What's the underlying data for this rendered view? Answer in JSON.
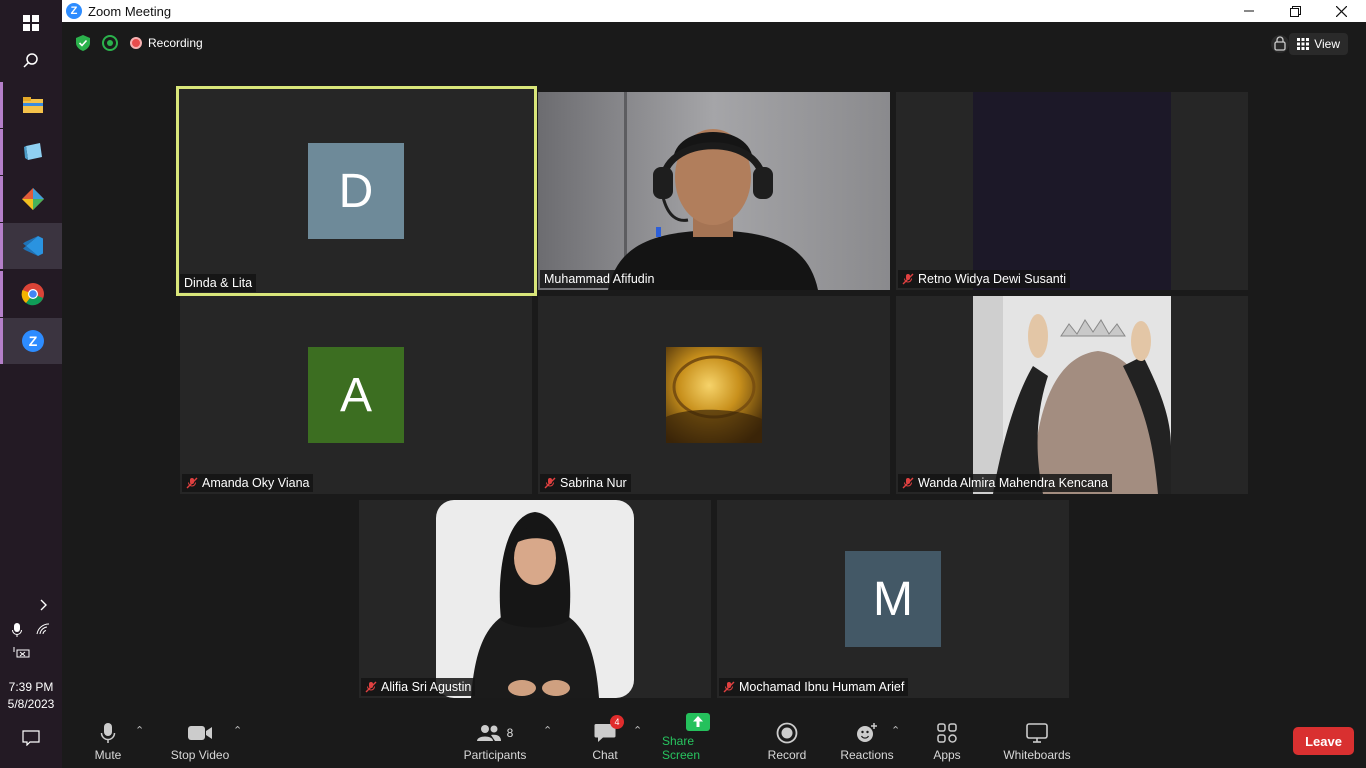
{
  "window": {
    "title": "Zoom Meeting"
  },
  "taskbar": {
    "time": "7:39 PM",
    "date": "5/8/2023"
  },
  "meeting": {
    "recording_label": "Recording",
    "view_label": "View"
  },
  "participants": [
    {
      "name": "Dinda & Lita",
      "initial": "D",
      "muted": false,
      "speaker": true,
      "avatar_color": "#6e8a99"
    },
    {
      "name": "Muhammad Afifudin",
      "initial": "",
      "muted": false,
      "speaker": false,
      "video": "webcam"
    },
    {
      "name": "Retno Widya Dewi Susanti",
      "initial": "",
      "muted": true,
      "speaker": false,
      "video": "dark"
    },
    {
      "name": "Amanda Oky Viana",
      "initial": "A",
      "muted": true,
      "speaker": false,
      "avatar_color": "#3c6e21"
    },
    {
      "name": "Sabrina Nur",
      "initial": "",
      "muted": true,
      "speaker": false,
      "video": "profile-photo"
    },
    {
      "name": "Wanda Almira Mahendra Kencana",
      "initial": "",
      "muted": true,
      "speaker": false,
      "video": "profile-photo"
    },
    {
      "name": "Alifia Sri Agustin",
      "initial": "",
      "muted": true,
      "speaker": false,
      "video": "profile-photo"
    },
    {
      "name": "Mochamad Ibnu Humam Arief",
      "initial": "M",
      "muted": true,
      "speaker": false,
      "avatar_color": "#435866"
    }
  ],
  "toolbar": {
    "mute": "Mute",
    "stop_video": "Stop Video",
    "participants": "Participants",
    "participants_count": "8",
    "chat": "Chat",
    "chat_badge": "4",
    "share_screen": "Share Screen",
    "record": "Record",
    "reactions": "Reactions",
    "apps": "Apps",
    "whiteboards": "Whiteboards",
    "leave": "Leave"
  },
  "colors": {
    "speaker_border": "#d9e67a",
    "share_green": "#25c15c",
    "leave_red": "#d93030"
  }
}
